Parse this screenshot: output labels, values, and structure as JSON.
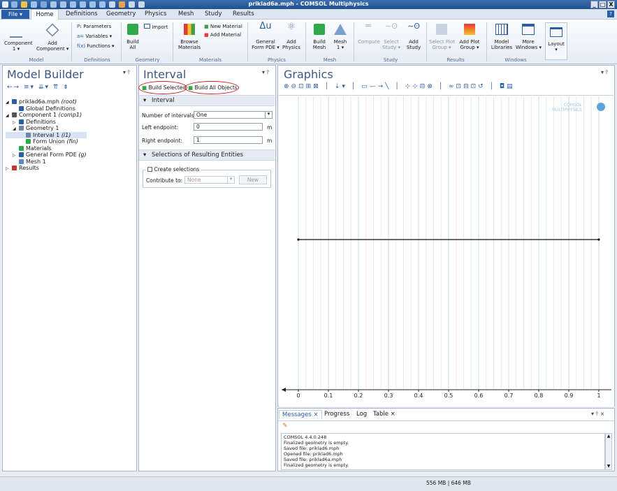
{
  "window": {
    "title": "priklad6a.mph - COMSOL Multiphysics",
    "min": "_",
    "max": "□",
    "close": "X"
  },
  "menu": {
    "file": "File ▾",
    "tabs": [
      "Home",
      "Definitions",
      "Geometry",
      "Physics",
      "Mesh",
      "Study",
      "Results"
    ],
    "help": "?"
  },
  "ribbon": {
    "model": {
      "component": "Component\n1 ▾",
      "add_component": "Add\nComponent ▾",
      "group": "Model"
    },
    "definitions": {
      "parameters": "Parameters",
      "variables": "Variables ▾",
      "functions": "Functions ▾",
      "group": "Definitions"
    },
    "geometry": {
      "build_all": "Build\nAll",
      "import": "Import",
      "group": "Geometry"
    },
    "materials": {
      "browse": "Browse\nMaterials",
      "new": "New Material",
      "add": "Add Material",
      "group": "Materials"
    },
    "physics": {
      "general": "General\nForm PDE ▾",
      "add": "Add\nPhysics",
      "group": "Physics"
    },
    "mesh": {
      "build": "Build\nMesh",
      "mesh1": "Mesh\n1 ▾",
      "group": "Mesh"
    },
    "study": {
      "compute": "Compute",
      "select": "Select\nStudy ▾",
      "add": "Add\nStudy",
      "group": "Study"
    },
    "results": {
      "select_plot": "Select Plot\nGroup ▾",
      "add_plot": "Add Plot\nGroup ▾",
      "group": "Results"
    },
    "windows": {
      "model_lib": "Model\nLibraries",
      "more": "More\nWindows ▾",
      "group": "Windows"
    },
    "layout": "Layout\n▾"
  },
  "model_builder": {
    "title": "Model Builder",
    "tree": [
      {
        "text": "priklad6a.mph",
        "italic": "(root)",
        "indent": 0,
        "exp": "◢"
      },
      {
        "text": "Global Definitions",
        "italic": "",
        "indent": 1,
        "exp": ""
      },
      {
        "text": "Component 1",
        "italic": "(comp1)",
        "indent": 0,
        "exp": "◢"
      },
      {
        "text": "Definitions",
        "italic": "",
        "indent": 1,
        "exp": "▷"
      },
      {
        "text": "Geometry 1",
        "italic": "",
        "indent": 1,
        "exp": "◢"
      },
      {
        "text": "Interval 1",
        "italic": "(i1)",
        "indent": 2,
        "exp": ""
      },
      {
        "text": "Form Union",
        "italic": "(fin)",
        "indent": 2,
        "exp": ""
      },
      {
        "text": "Materials",
        "italic": "",
        "indent": 1,
        "exp": ""
      },
      {
        "text": "General Form PDE",
        "italic": "(g)",
        "indent": 1,
        "exp": "▷"
      },
      {
        "text": "Mesh 1",
        "italic": "",
        "indent": 1,
        "exp": ""
      },
      {
        "text": "Results",
        "italic": "",
        "indent": 0,
        "exp": "▷"
      }
    ]
  },
  "settings": {
    "title": "Interval",
    "build_selected": "Build Selected",
    "build_all": "Build All Objects",
    "section_interval": "Interval",
    "num_intervals_label": "Number of intervals:",
    "num_intervals_value": "One",
    "left_label": "Left endpoint:",
    "left_value": "0",
    "right_label": "Right endpoint:",
    "right_value": "1",
    "unit": "m",
    "section_selections": "Selections of Resulting Entities",
    "create_selections": "Create selections",
    "contribute_label": "Contribute to:",
    "contribute_value": "None",
    "new_button": "New"
  },
  "graphics": {
    "title": "Graphics",
    "logo": "COMSOL\nMULTIPHYSICS",
    "xticks": [
      "0",
      "0.1",
      "0.2",
      "0.3",
      "0.4",
      "0.5",
      "0.6",
      "0.7",
      "0.8",
      "0.9",
      "1"
    ],
    "segment": [
      0,
      1
    ]
  },
  "messages": {
    "tabs": [
      "Messages ×",
      "Progress",
      "Log",
      "Table ×"
    ],
    "lines": [
      "COMSOL 4.4.0.248",
      "Finalized geometry is empty.",
      "Saved file: priklad6.mph",
      "Opened file: priklad6.mph",
      "Saved file: priklad6a.mph",
      "Finalized geometry is empty."
    ]
  },
  "status": {
    "memory": "556 MB | 646 MB"
  },
  "colors": {
    "accent": "#2a5da8",
    "highlight": "#d7e4f5",
    "callout": "#d11a1a"
  }
}
